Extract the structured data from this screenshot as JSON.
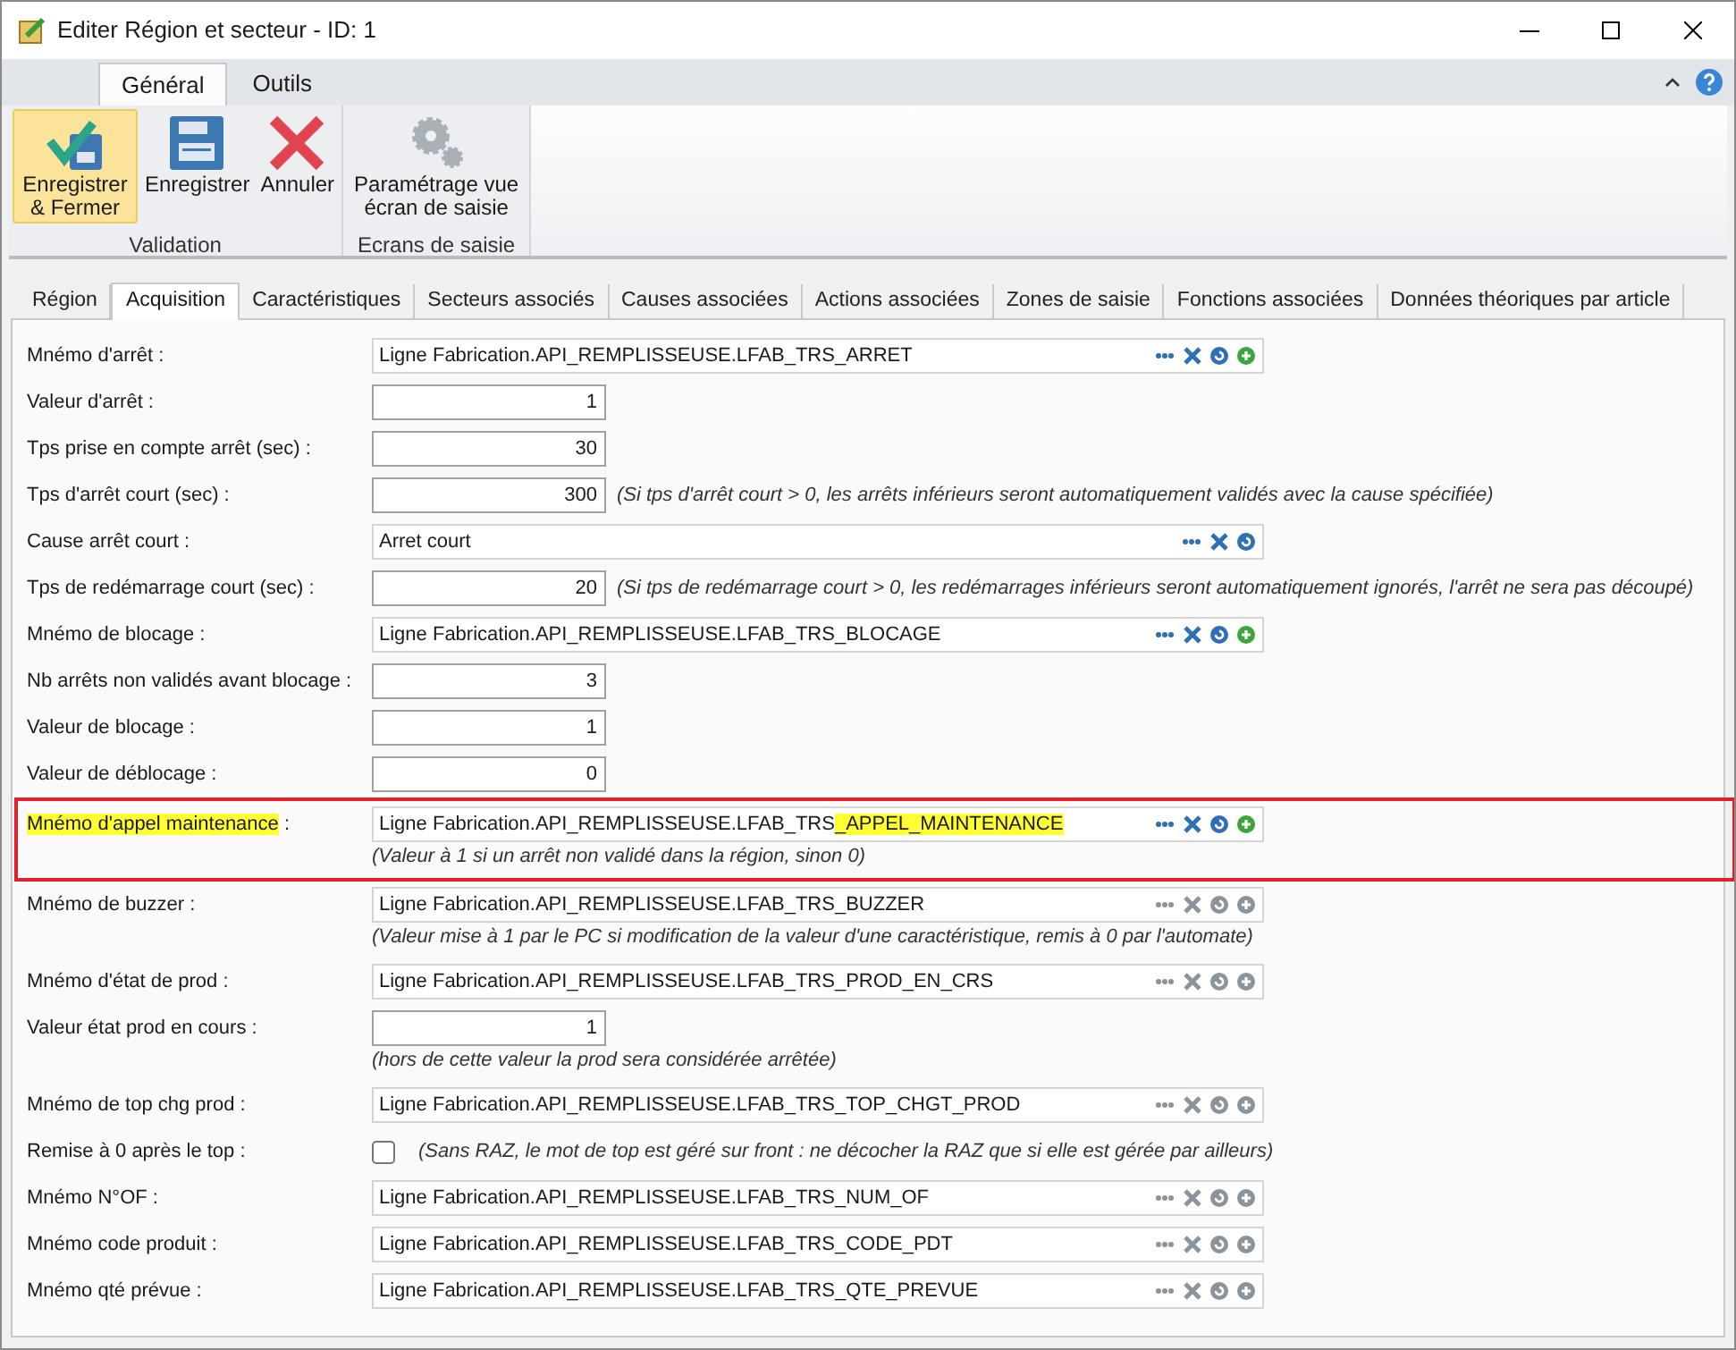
{
  "window": {
    "title": "Editer Région et secteur - ID: 1"
  },
  "ribbon": {
    "tabs": [
      {
        "label": "Général",
        "selected": true
      },
      {
        "label": "Outils",
        "selected": false
      }
    ],
    "groups": [
      {
        "title": "Validation",
        "buttons": [
          {
            "kind": "save_close",
            "label": "Enregistrer & Fermer",
            "selected": true
          },
          {
            "kind": "save",
            "label": "Enregistrer",
            "selected": false
          },
          {
            "kind": "cancel",
            "label": "Annuler",
            "selected": false
          }
        ]
      },
      {
        "title": "Ecrans de saisie",
        "buttons": [
          {
            "kind": "settings",
            "label": "Paramétrage vue écran de saisie",
            "selected": false
          }
        ]
      }
    ]
  },
  "tabs": [
    {
      "label": "Région",
      "selected": false
    },
    {
      "label": "Acquisition",
      "selected": true
    },
    {
      "label": "Caractéristiques",
      "selected": false
    },
    {
      "label": "Secteurs associés",
      "selected": false
    },
    {
      "label": "Causes associées",
      "selected": false
    },
    {
      "label": "Actions associées",
      "selected": false
    },
    {
      "label": "Zones de saisie",
      "selected": false
    },
    {
      "label": "Fonctions associées",
      "selected": false
    },
    {
      "label": "Données théoriques par article",
      "selected": false
    }
  ],
  "form": [
    {
      "kind": "mnemo",
      "label": "Mnémo d'arrêt :",
      "value": "Ligne Fabrication.API_REMPLISSEUSE.LFAB_TRS_ARRET",
      "add_button": true,
      "buttons_enabled": true
    },
    {
      "kind": "number",
      "label": "Valeur d'arrêt :",
      "value": "1"
    },
    {
      "kind": "number",
      "label": "Tps prise en compte arrêt (sec) :",
      "value": "30"
    },
    {
      "kind": "number",
      "label": "Tps d'arrêt court (sec) :",
      "value": "300",
      "note": "(Si tps d'arrêt court > 0, les arrêts inférieurs seront automatiquement validés avec la cause spécifiée)"
    },
    {
      "kind": "mnemo",
      "label": "Cause arrêt court :",
      "value": "Arret court",
      "add_button": false,
      "buttons_enabled": true
    },
    {
      "kind": "number",
      "label": "Tps de redémarrage court (sec) :",
      "value": "20",
      "note": "(Si tps de redémarrage court > 0, les redémarrages inférieurs seront automatiquement ignorés, l'arrêt ne sera pas découpé)"
    },
    {
      "kind": "mnemo",
      "label": "Mnémo de blocage :",
      "value": "Ligne Fabrication.API_REMPLISSEUSE.LFAB_TRS_BLOCAGE",
      "add_button": true,
      "buttons_enabled": true
    },
    {
      "kind": "number",
      "label": "Nb arrêts non validés avant blocage :",
      "value": "3"
    },
    {
      "kind": "number",
      "label": "Valeur de blocage :",
      "value": "1"
    },
    {
      "kind": "number",
      "label": "Valeur de déblocage :",
      "value": "0"
    },
    {
      "kind": "mnemo",
      "label": "Mnémo d'appel maintenance",
      "label_suffix": " :",
      "highlighted": true,
      "value": "Ligne Fabrication.API_REMPLISSEUSE.LFAB_TRS",
      "value_highlight": "_APPEL_MAINTENANCE",
      "add_button": true,
      "buttons_enabled": true,
      "note_below": "(Valeur à 1 si un arrêt non validé dans la région, sinon 0)"
    },
    {
      "kind": "mnemo",
      "label": "Mnémo de buzzer :",
      "value": "Ligne Fabrication.API_REMPLISSEUSE.LFAB_TRS_BUZZER",
      "add_button": true,
      "buttons_enabled": false,
      "note_below": "(Valeur mise à 1 par le PC si modification de la valeur d'une caractéristique, remis à 0 par l'automate)"
    },
    {
      "kind": "mnemo",
      "label": "Mnémo d'état de prod :",
      "value": "Ligne Fabrication.API_REMPLISSEUSE.LFAB_TRS_PROD_EN_CRS",
      "add_button": true,
      "buttons_enabled": false
    },
    {
      "kind": "number",
      "label": "Valeur état prod en cours :",
      "value": "1",
      "note_below": "(hors de cette valeur la prod sera considérée arrêtée)"
    },
    {
      "kind": "mnemo",
      "label": "Mnémo de top chg prod :",
      "value": "Ligne Fabrication.API_REMPLISSEUSE.LFAB_TRS_TOP_CHGT_PROD",
      "add_button": true,
      "buttons_enabled": false
    },
    {
      "kind": "checkbox",
      "label": "Remise à 0 après le top :",
      "checked": false,
      "note": "(Sans RAZ, le mot de top est géré sur front : ne décocher la RAZ que si elle est gérée par ailleurs)"
    },
    {
      "kind": "mnemo",
      "label": "Mnémo N°OF :",
      "value": "Ligne Fabrication.API_REMPLISSEUSE.LFAB_TRS_NUM_OF",
      "add_button": true,
      "buttons_enabled": false
    },
    {
      "kind": "mnemo",
      "label": "Mnémo code produit :",
      "value": "Ligne Fabrication.API_REMPLISSEUSE.LFAB_TRS_CODE_PDT",
      "add_button": true,
      "buttons_enabled": false
    },
    {
      "kind": "mnemo",
      "label": "Mnémo qté prévue :",
      "value": "Ligne Fabrication.API_REMPLISSEUSE.LFAB_TRS_QTE_PREVUE",
      "add_button": true,
      "buttons_enabled": false
    }
  ]
}
